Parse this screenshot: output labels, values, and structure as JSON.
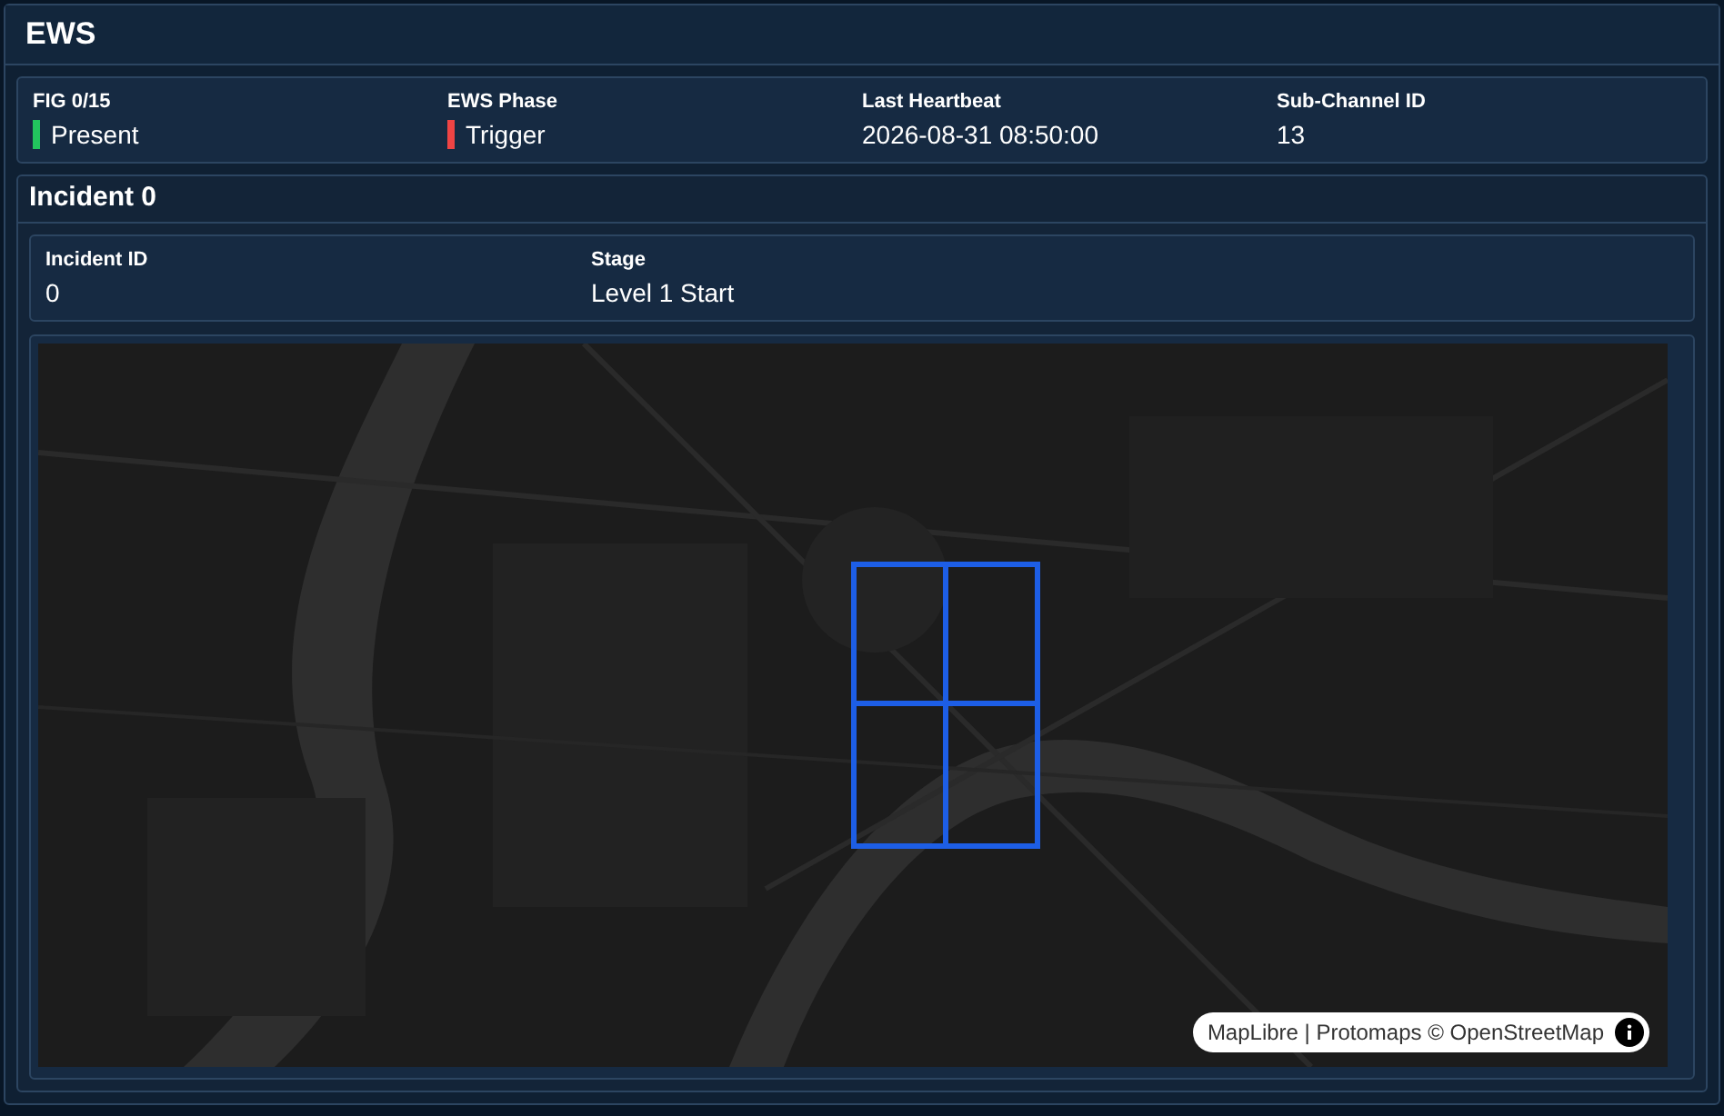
{
  "panel": {
    "title": "EWS"
  },
  "status_fields": [
    {
      "label": "FIG 0/15",
      "value": "Present",
      "color": "#22c55e"
    },
    {
      "label": "EWS Phase",
      "value": "Trigger",
      "color": "#ef4444"
    },
    {
      "label": "Last Heartbeat",
      "value": "2026-08-31 08:50:00"
    },
    {
      "label": "Sub-Channel ID",
      "value": "13"
    }
  ],
  "incident": {
    "title": "Incident 0",
    "fields": [
      {
        "label": "Incident ID",
        "value": "0"
      },
      {
        "label": "Stage",
        "value": "Level 1 Start"
      }
    ],
    "map": {
      "kind": "picture",
      "attribution": "MapLibre | Protomaps © OpenStreetMap"
    }
  }
}
